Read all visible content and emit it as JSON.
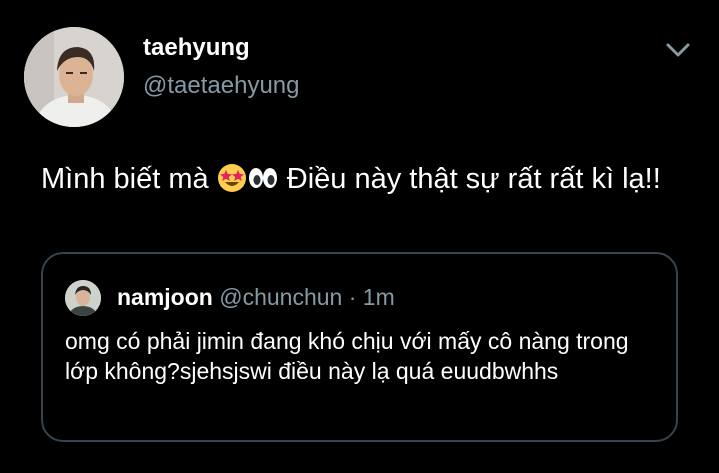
{
  "tweet": {
    "author": {
      "display_name": "taehyung",
      "handle": "@taetaehyung"
    },
    "text_part1": "Mình biết mà ",
    "text_part2": " Điều này thật sự rất rất kì lạ!!",
    "emojis": [
      "star-struck",
      "eyes"
    ]
  },
  "quoted_tweet": {
    "display_name": "namjoon",
    "handle": "@chunchun",
    "separator": "·",
    "time": "1m",
    "text": "omg có phải jimin đang khó chịu với mấy cô nàng trong lớp không?sjehsjswi điều này lạ quá euudbwhhs"
  },
  "colors": {
    "background": "#000000",
    "text": "#ffffff",
    "secondary": "#8899a6",
    "border": "#38444d"
  }
}
